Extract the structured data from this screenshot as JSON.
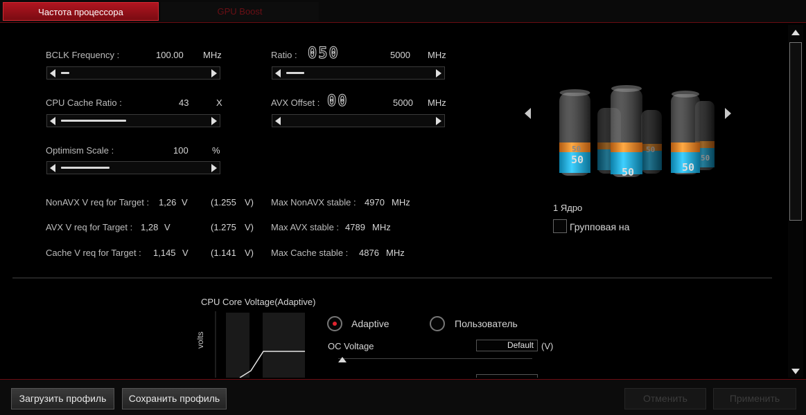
{
  "tabs": {
    "cpu_freq": "Частота процессора",
    "gpu_boost": "GPU Boost"
  },
  "bclk": {
    "label": "BCLK Frequency :",
    "value": "100.00",
    "unit": "MHz",
    "level": 0.05
  },
  "ratio": {
    "label": "Ratio :",
    "digits": "050",
    "value": "5000",
    "unit": "MHz",
    "level": 0.12
  },
  "cache": {
    "label": "CPU Cache Ratio :",
    "value": "43",
    "unit": "X",
    "level": 0.4
  },
  "avx": {
    "label": "AVX Offset :",
    "digits": "00",
    "value": "5000",
    "unit": "MHz",
    "level": 0.0
  },
  "optimism": {
    "label": "Optimism Scale :",
    "value": "100",
    "unit": "%",
    "level": 0.32
  },
  "vreq": [
    {
      "label": "NonAVX V req for Target :",
      "value": "1,26",
      "unit": "V",
      "paren": "(1.255",
      "paren_unit": "V)"
    },
    {
      "label": "AVX V req for Target :",
      "value": "1,28",
      "unit": "V",
      "paren": "(1.275",
      "paren_unit": "V)"
    },
    {
      "label": "Cache V req for Target :",
      "value": "1,145",
      "unit": "V",
      "paren": "(1.141",
      "paren_unit": "V)"
    }
  ],
  "stable": [
    {
      "label": "Max NonAVX stable :",
      "value": "4970",
      "unit": "MHz"
    },
    {
      "label": "Max AVX stable :",
      "value": "4789",
      "unit": "MHz"
    },
    {
      "label": "Max Cache stable :",
      "value": "4876",
      "unit": "MHz"
    }
  ],
  "cores": {
    "core_label": "1 Ядро",
    "group_label": "Групповая на",
    "front": [
      "50",
      "50",
      "50"
    ],
    "back": [
      "50",
      "50",
      "50"
    ]
  },
  "voltage": {
    "title": "CPU Core Voltage(Adaptive)",
    "axis_label": "volts",
    "mode_adaptive": "Adaptive",
    "mode_user": "Пользователь",
    "oc_label": "OC Voltage",
    "oc_value": "Default",
    "oc_unit": "(V)"
  },
  "buttons": {
    "load": "Загрузить профиль",
    "save": "Сохранить профиль",
    "cancel": "Отменить",
    "apply": "Применить"
  },
  "colors": {
    "accent": "#b01520",
    "cyan": "#1fb8e6",
    "orange": "#f08a24"
  }
}
